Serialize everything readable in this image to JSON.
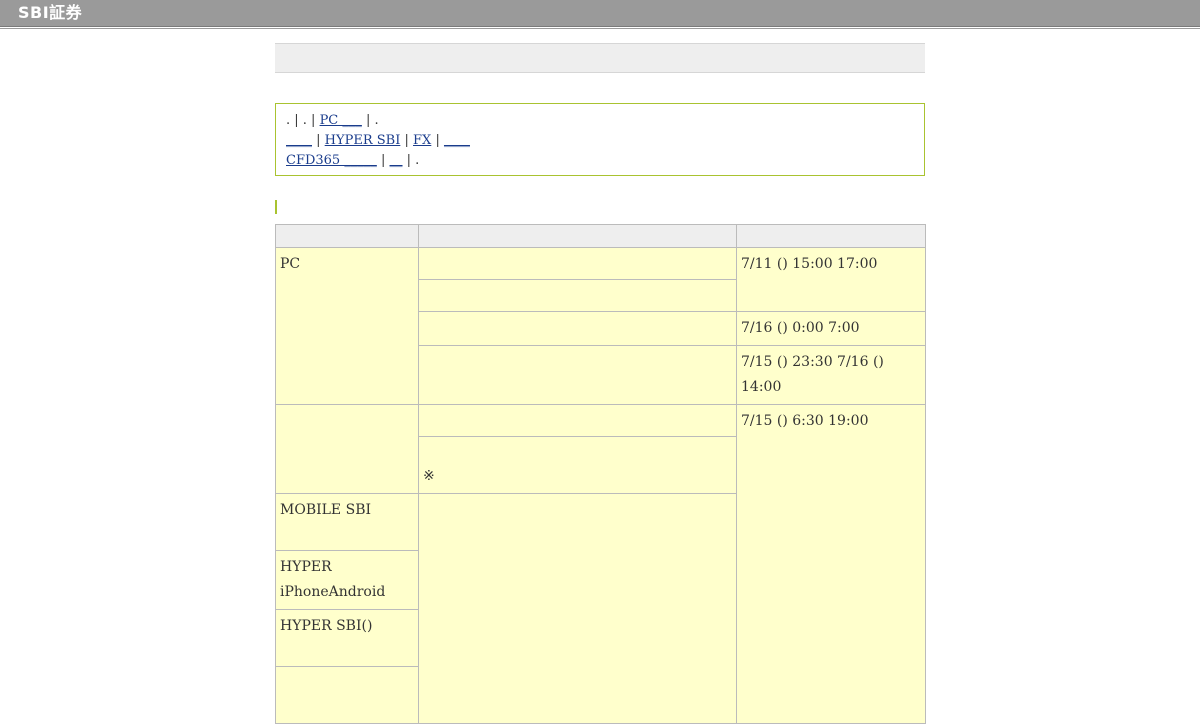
{
  "header": {
    "logo_text": "SBI証券"
  },
  "nav": {
    "line1_prefix": ". | . |",
    "pc_link": "PC ___",
    "line1_suffix": "| .",
    "line2_link1": "____",
    "sep1": "|",
    "hyper_sbi_link": "HYPER SBI",
    "sep2": "|",
    "fx_link": "FX",
    "sep3": "|",
    "line2_link4": "____",
    "cfd_link": "CFD365 _____",
    "sep4": "|",
    "line3_link2": "__",
    "line3_suffix": "| ."
  },
  "table": {
    "headers": [
      "",
      "",
      ""
    ],
    "rows": {
      "pc_label": "PC",
      "time_1": "7/11 () 15:00  17:00",
      "time_2": "7/16 () 0:00  7:00",
      "time_3": "7/15 () 23:30  7/16 () 14:00",
      "time_4": "7/15 () 6:30  19:00",
      "note_mark": "※",
      "mobile_label": "MOBILE SBI",
      "hyper_label": "HYPER iPhoneAndroid",
      "hyper_sbi_label": "HYPER SBI()"
    }
  }
}
